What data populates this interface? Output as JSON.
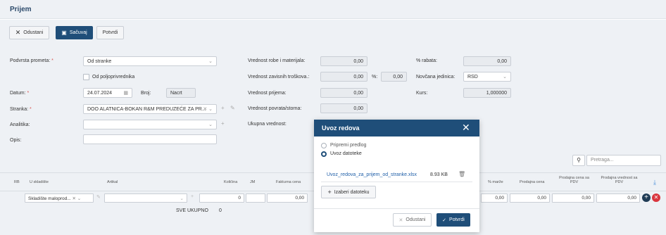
{
  "page_title": "Prijem",
  "toolbar": {
    "cancel_label": "Odustani",
    "save_label": "Sačuvaj",
    "confirm_label": "Potvrdi"
  },
  "form": {
    "transaction_type_label": "Podvrsta prometa:",
    "transaction_type_value": "Od stranke",
    "agri_label": "Od poljoprivrednika",
    "date_label": "Datum:",
    "date_value": "24.07.2024",
    "number_label": "Broj:",
    "number_value": "Nacrt",
    "party_label": "Stranka:",
    "party_value": "DOO ALATNICA-BOKAN R&M PREDUZEĆE ZA PR...",
    "analytics_label": "Analitika:",
    "description_label": "Opis:",
    "goods_value_label": "Vrednost robe i materijala:",
    "goods_value": "0,00",
    "dependent_costs_label": "Vrednost zavisnih troškova.:",
    "dependent_costs_value": "0,00",
    "percent_label": "%:",
    "percent_value": "0,00",
    "receipt_value_label": "Vrednost prijema:",
    "receipt_value": "0,00",
    "return_value_label": "Vrednost povrata/storna:",
    "return_value": "0,00",
    "total_value_label": "Ukupna vrednost:",
    "discount_label": "% rabata:",
    "discount_value": "0,00",
    "currency_label": "Novčana jedinica:",
    "currency_value": "RSD",
    "rate_label": "Kurs:",
    "rate_value": "1,000000"
  },
  "grid": {
    "search_placeholder": "Pretraga...",
    "headers": [
      "RB",
      "U skladište",
      "Artikal",
      "Količina",
      "JM",
      "Fakturna cena",
      "% marže",
      "Prodajna cena",
      "Prodajna cena sa PDV",
      "Prodajna vrednost sa PDV"
    ],
    "row": {
      "warehouse": "Skladište maloprod...",
      "quantity": "0",
      "invoice_price": "0,00",
      "margin": "0,00",
      "sale_price": "0,00",
      "sale_price_vat": "0,00",
      "sale_value_vat": "0,00"
    },
    "total_label": "SVE UKUPNO",
    "total_value": "0"
  },
  "modal": {
    "title": "Uvoz redova",
    "option_template": "Pripremi predlog",
    "option_import": "Uvoz datoteke",
    "file_name": "Uvoz_redova_za_prijem_od_stranke.xlsx",
    "file_size": "8.93 KB",
    "choose_files_label": "Izaberi datoteku",
    "cancel_label": "Odustani",
    "confirm_label": "Potvrdi"
  }
}
